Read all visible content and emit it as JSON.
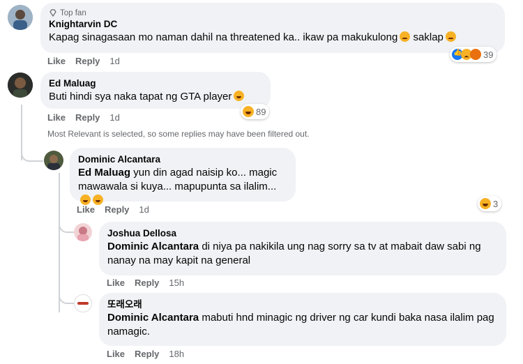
{
  "comments": [
    {
      "badge": "Top fan",
      "author": "Knightarvin DC",
      "text": "Kapag sinagasaan mo naman dahil na threatened ka.. ikaw pa makukulong",
      "text_tail": "saklap",
      "like": "Like",
      "reply": "Reply",
      "time": "1d",
      "reaction_count": "39"
    },
    {
      "author": "Ed Maluag",
      "text": "Buti hindi sya naka tapat ng GTA player",
      "like": "Like",
      "reply": "Reply",
      "time": "1d",
      "reaction_count": "89"
    }
  ],
  "filter_notice": "Most Relevant is selected, so some replies may have been filtered out.",
  "replies": [
    {
      "author": "Dominic Alcantara",
      "mention": "Ed Maluag",
      "text": "yun din agad naisip ko... magic mawawala si kuya... mapupunta sa ilalim...",
      "like": "Like",
      "reply": "Reply",
      "time": "1d",
      "reaction_count": "3"
    },
    {
      "author": "Joshua Dellosa",
      "mention": "Dominic Alcantara",
      "text": "di niya pa nakikila ung nag sorry sa tv at mabait daw sabi ng nanay na may kapit na general",
      "like": "Like",
      "reply": "Reply",
      "time": "15h"
    },
    {
      "author": "또래오래",
      "mention": "Dominic Alcantara",
      "text": "mabuti hnd minagic ng driver ng car kundi baka nasa ilalim pag namagic.",
      "like": "Like",
      "reply": "Reply",
      "time": "18h"
    }
  ]
}
